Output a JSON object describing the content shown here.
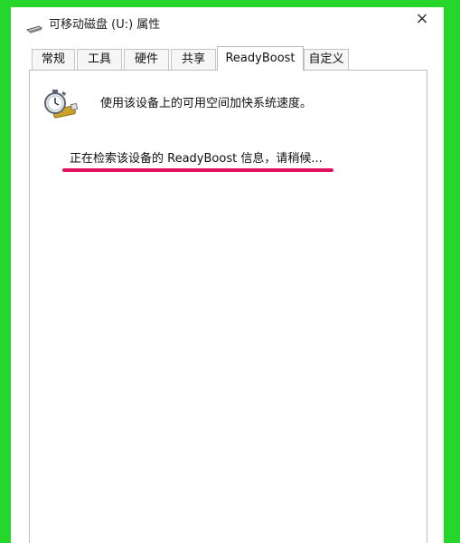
{
  "window": {
    "title": "可移动磁盘 (U:) 属性",
    "close_label": "×"
  },
  "tabs": [
    {
      "label": "常规"
    },
    {
      "label": "工具"
    },
    {
      "label": "硬件"
    },
    {
      "label": "共享"
    },
    {
      "label": "ReadyBoost",
      "active": true
    },
    {
      "label": "自定义"
    }
  ],
  "readyboost": {
    "icon": "readyboost-stopwatch-icon",
    "description": "使用该设备上的可用空间加快系统速度。",
    "status": "正在检索该设备的 ReadyBoost 信息，请稍候..."
  },
  "colors": {
    "frame": "#27d62a",
    "annotation_underline": "#e0115f"
  }
}
